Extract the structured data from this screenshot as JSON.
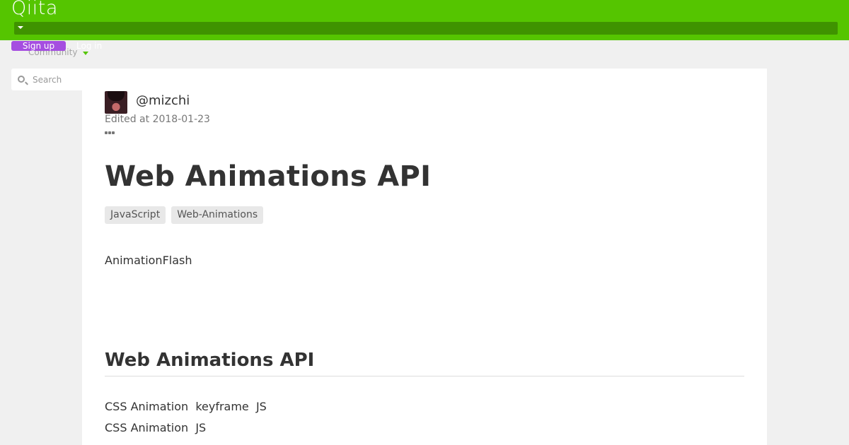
{
  "header": {
    "logo": "Qiita",
    "signup_label": "Sign up",
    "login_label": "Log in",
    "community_label": "Community"
  },
  "search": {
    "placeholder": "Search"
  },
  "colors": {
    "brand": "#55c500",
    "signup": "#a54ee0"
  },
  "article": {
    "author": "@mizchi",
    "edited": "Edited at 2018-01-23",
    "title": "Web Animations API",
    "tags": [
      "JavaScript",
      "Web-Animations"
    ],
    "intro": "AnimationFlash",
    "section_heading": "Web Animations API",
    "paragraphs": [
      "CSS Animation  keyframe  JS",
      "CSS Animation  JS"
    ]
  }
}
